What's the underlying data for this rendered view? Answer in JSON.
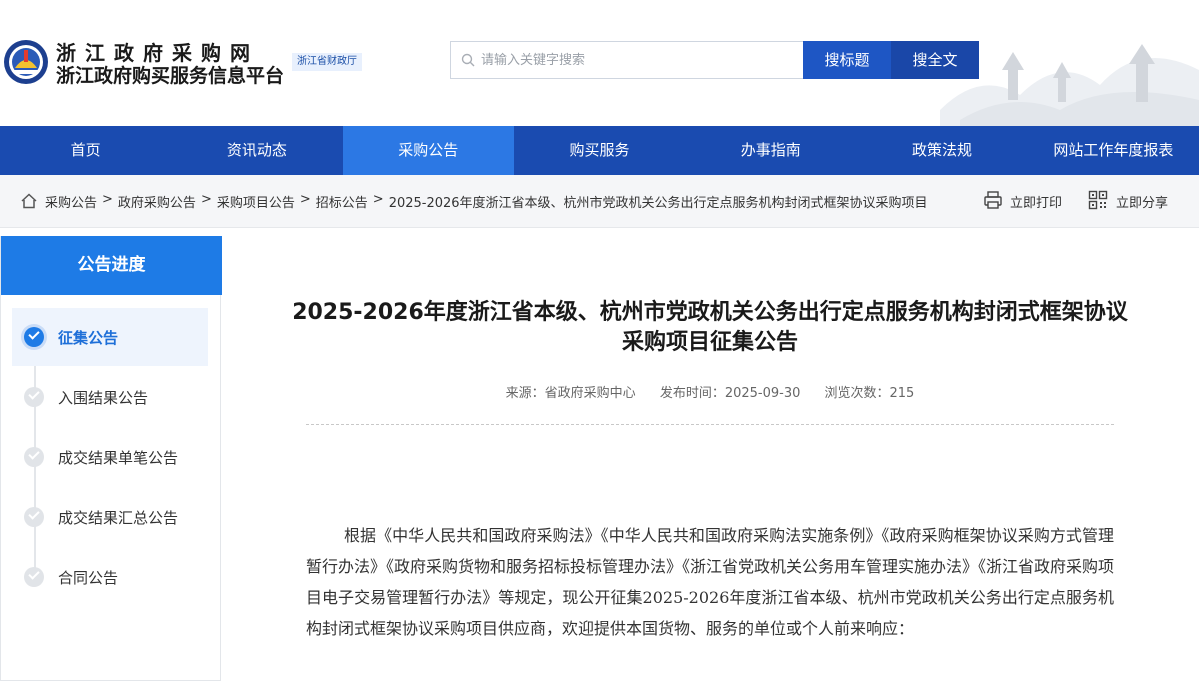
{
  "header": {
    "logo_line1": "浙江政府采购网",
    "logo_line2": "浙江政府购买服务信息平台",
    "dept_badge": "浙江省财政厅"
  },
  "search": {
    "placeholder": "请输入关键字搜索",
    "btn_title": "搜标题",
    "btn_full": "搜全文"
  },
  "nav": {
    "items": [
      "首页",
      "资讯动态",
      "采购公告",
      "购买服务",
      "办事指南",
      "政策法规",
      "网站工作年度报表"
    ],
    "active_index": 2
  },
  "breadcrumb": {
    "items": [
      "采购公告",
      "政府采购公告",
      "采购项目公告",
      "招标公告"
    ],
    "separator": ">",
    "current": "2025-2026年度浙江省本级、杭州市党政机关公务出行定点服务机构封闭式框架协议采购项目"
  },
  "actions": {
    "print": "立即打印",
    "share": "立即分享"
  },
  "sidebar": {
    "title": "公告进度",
    "steps": [
      "征集公告",
      "入围结果公告",
      "成交结果单笔公告",
      "成交结果汇总公告",
      "合同公告"
    ],
    "active_index": 0
  },
  "article": {
    "title": "2025-2026年度浙江省本级、杭州市党政机关公务出行定点服务机构封闭式框架协议采购项目征集公告",
    "source": "来源：省政府采购中心",
    "publish_time": "发布时间：2025-09-30",
    "views": "浏览次数：215",
    "body": "根据《中华人民共和国政府采购法》《中华人民共和国政府采购法实施条例》《政府采购框架协议采购方式管理暂行办法》《政府采购货物和服务招标投标管理办法》《浙江省党政机关公务用车管理实施办法》《浙江省政府采购项目电子交易管理暂行办法》等规定，现公开征集2025-2026年度浙江省本级、杭州市党政机关公务出行定点服务机构封闭式框架协议采购项目供应商，欢迎提供本国货物、服务的单位或个人前来响应："
  },
  "colors": {
    "nav_bg": "#1a4bb0",
    "nav_active": "#2c78e4",
    "sidebar_head": "#1e7be6",
    "btn_title": "#1e56c4",
    "btn_full": "#1a47a8"
  }
}
